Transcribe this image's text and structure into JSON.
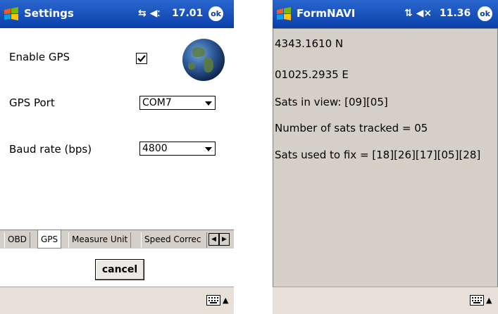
{
  "settings": {
    "title": "Settings",
    "tray_icons": "↔ ◀€",
    "time": "17.01",
    "ok_label": "ok",
    "enable_gps_label": "Enable GPS",
    "enable_gps_checked": true,
    "gps_port_label": "GPS Port",
    "gps_port_value": "COM7",
    "baud_label": "Baud rate (bps)",
    "baud_value": "4800",
    "tabs": [
      {
        "label": "OBD",
        "active": false
      },
      {
        "label": "GPS",
        "active": true
      },
      {
        "label": "Measure Unit",
        "active": false
      },
      {
        "label": "Speed Correc",
        "active": false
      }
    ],
    "cancel_label": "cancel"
  },
  "navi": {
    "title": "FormNAVI",
    "time": "11.36",
    "ok_label": "ok",
    "lines": [
      "4343.1610 N",
      "01025.2935 E",
      "Sats in view: [09][05]",
      "Number of sats tracked = 05",
      "Sats used to fix = [18][26][17][05][28]"
    ]
  },
  "colors": {
    "titlebar": "#0a3fa8",
    "tabstrip": "#d4d0c8",
    "sip": "#e6e0d8"
  }
}
